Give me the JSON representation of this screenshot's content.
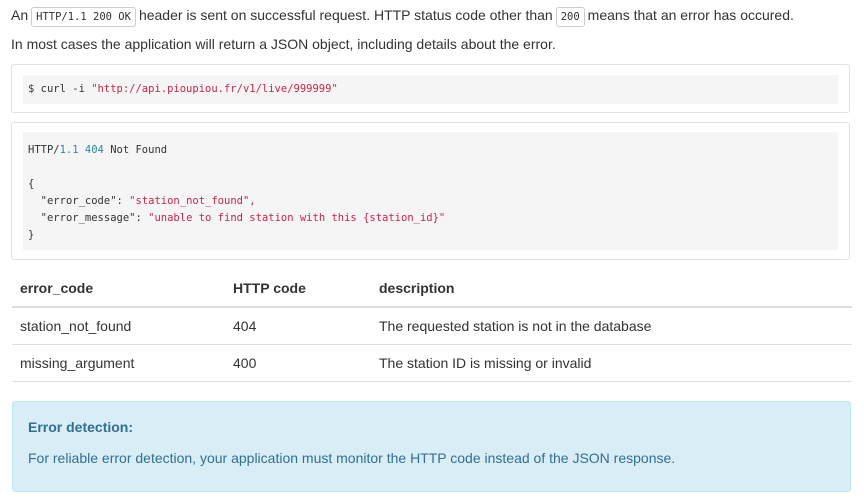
{
  "intro": {
    "line1_a": "An",
    "line1_code": "HTTP/1.1 200 OK",
    "line1_b": "header is sent on successful request. HTTP status code other than",
    "line1_code2": "200",
    "line1_c": "means that an error has occured.",
    "line2": "In most cases the application will return a JSON object, including details about the error."
  },
  "request": {
    "prompt": "$ curl -i",
    "url": "\"http://api.pioupiou.fr/v1/live/999999\""
  },
  "response": {
    "proto": "HTTP/",
    "version": "1.1",
    "code": "404",
    "status": "Not Found",
    "open_brace": "{",
    "key1": "\"error_code\":",
    "val1": "\"station_not_found\",",
    "key2": "\"error_message\":",
    "val2": "\"unable to find station with this {station_id}\"",
    "close_brace": "}"
  },
  "table": {
    "headers": [
      "error_code",
      "HTTP code",
      "description"
    ],
    "rows": [
      [
        "station_not_found",
        "404",
        "The requested station is not in the database"
      ],
      [
        "missing_argument",
        "400",
        "The station ID is missing or invalid"
      ]
    ]
  },
  "alert": {
    "title": "Error detection:",
    "text": "For reliable error detection, your application must monitor the HTTP code instead of the JSON response."
  }
}
